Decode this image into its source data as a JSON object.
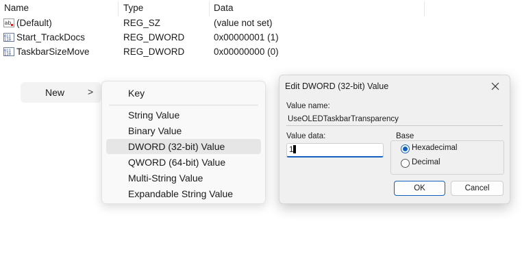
{
  "columns": {
    "name": "Name",
    "type": "Type",
    "data": "Data"
  },
  "rows": [
    {
      "name": "(Default)",
      "type": "REG_SZ",
      "data": "(value not set)",
      "icon": "string-value-icon"
    },
    {
      "name": "Start_TrackDocs",
      "type": "REG_DWORD",
      "data": "0x00000001 (1)",
      "icon": "binary-value-icon"
    },
    {
      "name": "TaskbarSizeMove",
      "type": "REG_DWORD",
      "data": "0x00000000 (0)",
      "icon": "binary-value-icon"
    }
  ],
  "context_menu": {
    "new_label": "New",
    "new_arrow": ">",
    "items": [
      "Key",
      "String Value",
      "Binary Value",
      "DWORD (32-bit) Value",
      "QWORD (64-bit) Value",
      "Multi-String Value",
      "Expandable String Value"
    ],
    "highlighted": "DWORD (32-bit) Value"
  },
  "dialog": {
    "title": "Edit DWORD (32-bit) Value",
    "value_name_label": "Value name:",
    "value_name": "UseOLEDTaskbarTransparency",
    "value_data_label": "Value data:",
    "value_data": "1",
    "base_label": "Base",
    "base_options": [
      "Hexadecimal",
      "Decimal"
    ],
    "base_selected": "Hexadecimal",
    "ok_label": "OK",
    "cancel_label": "Cancel"
  },
  "colors": {
    "accent": "#1160c0",
    "menu_highlight": "#e6e6e6"
  }
}
